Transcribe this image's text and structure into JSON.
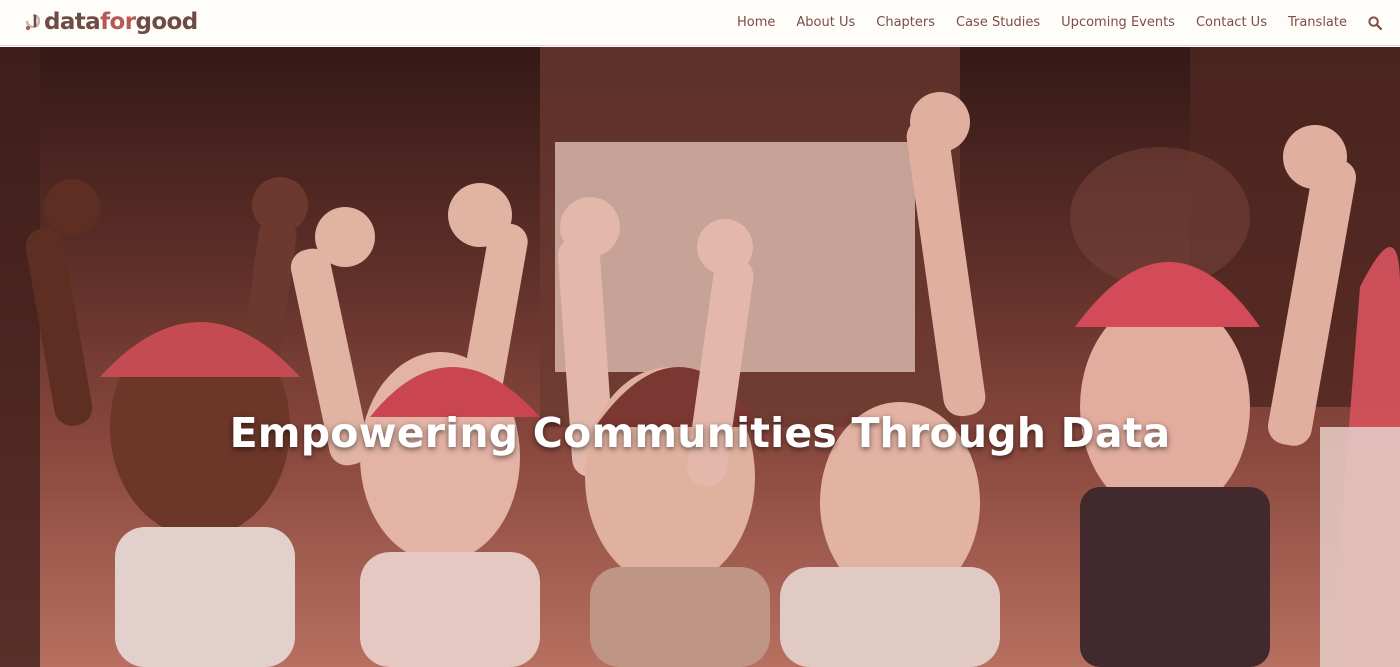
{
  "brand": {
    "logo_primary": "data",
    "logo_accent": "for",
    "logo_secondary": "good"
  },
  "nav": {
    "items": [
      {
        "label": "Home"
      },
      {
        "label": "About Us"
      },
      {
        "label": "Chapters"
      },
      {
        "label": "Case Studies"
      },
      {
        "label": "Upcoming Events"
      },
      {
        "label": "Contact Us"
      },
      {
        "label": "Translate"
      }
    ],
    "search_icon": "search-icon"
  },
  "hero": {
    "title": "Empowering Communities Through Data"
  },
  "colors": {
    "brand": "#b45a52",
    "nav_text": "#7d4d46",
    "hero_overlay": "#78281e"
  }
}
